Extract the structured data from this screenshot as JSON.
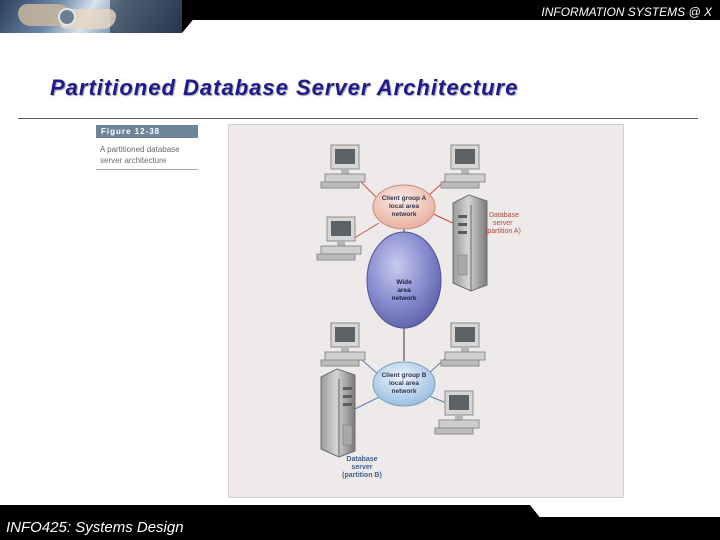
{
  "header": {
    "title": "INFORMATION SYSTEMS @ X"
  },
  "slide": {
    "title": "Partitioned Database Server Architecture"
  },
  "figure": {
    "label": "Figure 12-38",
    "caption_line1": "A partitioned database",
    "caption_line2": "server architecture"
  },
  "diagram": {
    "client_group_a": {
      "line1": "Client group A",
      "line2": "local area",
      "line3": "network"
    },
    "wan": {
      "line1": "Wide",
      "line2": "area",
      "line3": "network"
    },
    "client_group_b": {
      "line1": "Client group B",
      "line2": "local area",
      "line3": "network"
    },
    "server_a": {
      "line1": "Database",
      "line2": "server",
      "line3": "(partition A)"
    },
    "server_b": {
      "line1": "Database",
      "line2": "server",
      "line3": "(partition B)"
    }
  },
  "footer": {
    "title": "INFO425: Systems Design"
  },
  "colors": {
    "header_bg": "#000000",
    "title": "#1d1b8f",
    "wan_ellipse": "#7b7fc4",
    "lan_ellipse_a": "#f0c8bc",
    "lan_ellipse_b": "#b9d2ea",
    "diagram_bg": "#efeaea"
  }
}
